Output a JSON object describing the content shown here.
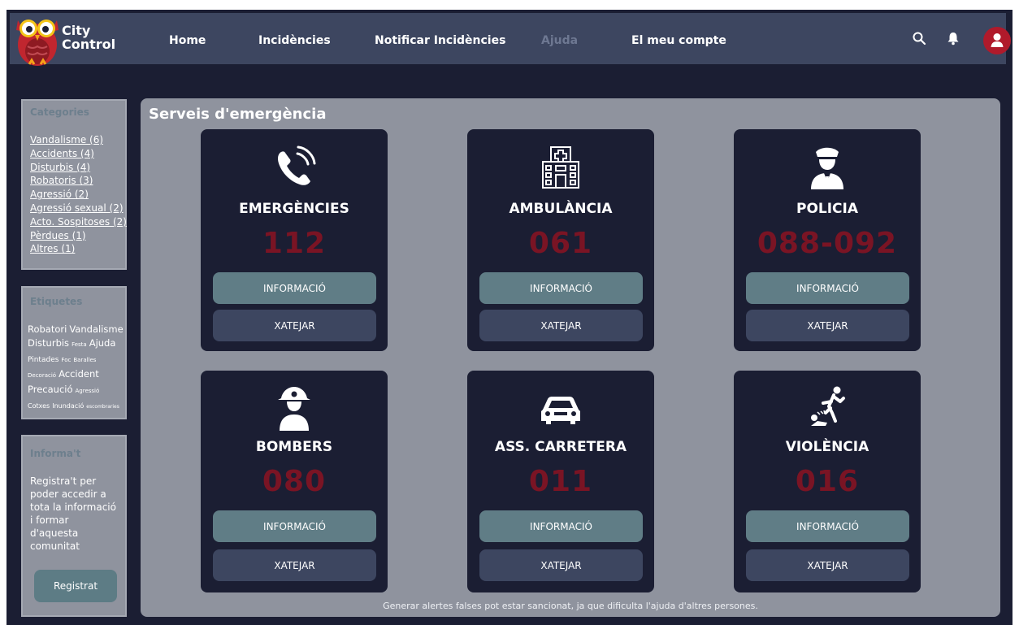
{
  "brand": {
    "line1": "City",
    "line2": "Control"
  },
  "nav": [
    {
      "label": "Home"
    },
    {
      "label": "Incidències"
    },
    {
      "label": "Notificar Incidències"
    },
    {
      "label": "Ajuda"
    },
    {
      "label": "El meu compte"
    }
  ],
  "header_icons": [
    "search-icon",
    "bell-icon",
    "user-icon"
  ],
  "sidebar": {
    "categories": {
      "title": "Categories",
      "items": [
        "Vandalisme (6)",
        "Accidents (4)",
        "Disturbis (4)",
        "Robatoris (3)",
        "Agressió (2)",
        "Agressió sexual (2)",
        "Acto. Sospitoses (2)",
        "Pèrdues (1)",
        "Altres (1)"
      ]
    },
    "tags": {
      "title": "Etiquetes",
      "items": [
        "Robatori",
        "Vandalisme",
        "Disturbis",
        "Festa",
        "Ajuda",
        "Pintades",
        "Foc",
        "Baralles",
        "Decoració",
        "Accident",
        "Precaució",
        "Agressió",
        "Cotxes",
        "Inundació",
        "escombraries"
      ]
    },
    "info": {
      "title": "Informa't",
      "text": "Registra't per poder accedir a tota la informació i formar d'aquesta comunitat",
      "button": "Registrat"
    }
  },
  "main": {
    "title": "Serveis d'emergència",
    "info_label": "INFORMACIÓ",
    "chat_label": "XATEJAR",
    "cards": [
      {
        "name": "EMERGÈNCIES",
        "number": "112",
        "icon": "phone-icon"
      },
      {
        "name": "AMBULÀNCIA",
        "number": "061",
        "icon": "hospital-icon"
      },
      {
        "name": "POLICIA",
        "number": "088-092",
        "icon": "police-officer-icon"
      },
      {
        "name": "BOMBERS",
        "number": "080",
        "icon": "firefighter-icon"
      },
      {
        "name": "ASS. CARRETERA",
        "number": "011",
        "icon": "car-icon"
      },
      {
        "name": "VIOLÈNCIA",
        "number": "016",
        "icon": "violence-icon"
      }
    ],
    "footer": "Generar alertes falses pot estar sancionat, ja que dificulta l'ajuda d'altres persones."
  },
  "colors": {
    "frame": "#1b1e33",
    "header": "#3d4660",
    "panel": "#8f939e",
    "info_button": "#607d86",
    "chat_button": "#3d4660",
    "number": "#7a1424",
    "avatar": "#b01a2b"
  }
}
